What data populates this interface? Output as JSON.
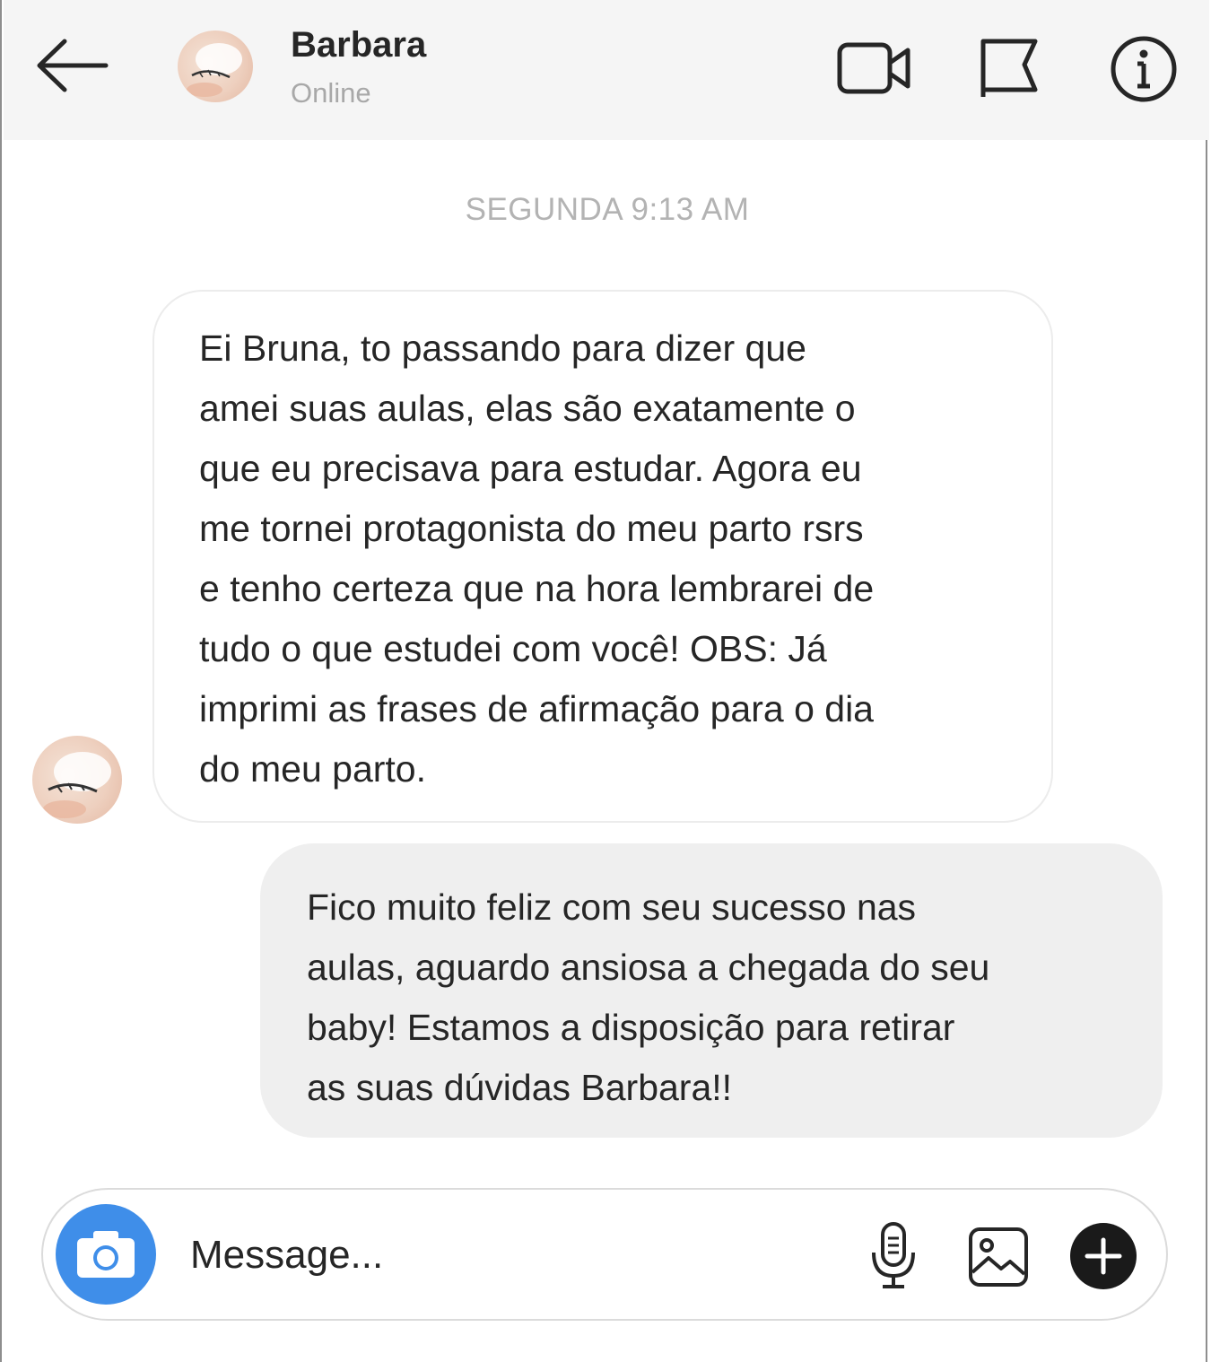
{
  "header": {
    "contact_name": "Barbara",
    "status": "Online",
    "icons": [
      "back-arrow-icon",
      "video-camera-icon",
      "flag-icon",
      "info-icon"
    ]
  },
  "conversation": {
    "timestamp": "SEGUNDA 9:13 AM",
    "messages": [
      {
        "direction": "incoming",
        "text": " Ei Bruna, to passando para dizer que\namei suas aulas, elas são exatamente o\nque eu precisava para estudar. Agora eu\nme tornei protagonista do meu parto rsrs\ne tenho certeza que na hora lembrarei de\ntudo o que estudei com você! OBS: Já\nimprimi as frases de afirmação para o dia\ndo meu parto."
      },
      {
        "direction": "outgoing",
        "text": " Fico muito feliz com seu sucesso nas\naulas, aguardo ansiosa a chegada do seu\nbaby! Estamos a disposição para retirar\nas suas dúvidas Barbara!!"
      }
    ]
  },
  "composer": {
    "placeholder": "Message...",
    "icons": [
      "camera-icon",
      "microphone-icon",
      "image-icon",
      "plus-icon"
    ],
    "camera_color": "#3f8ee9"
  },
  "colors": {
    "header_bg": "#f5f5f5",
    "outgoing_bubble_bg": "#efefef",
    "incoming_bubble_border": "#ececec",
    "timestamp_text": "#b3b3b3",
    "status_text": "#a8a8a8"
  }
}
